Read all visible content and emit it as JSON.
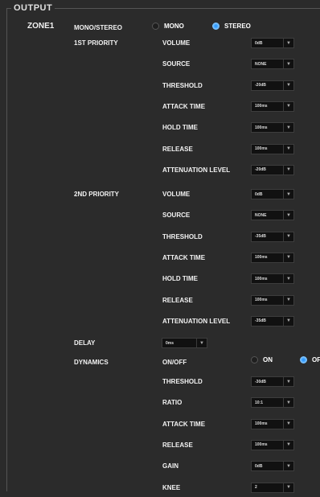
{
  "section_title": "OUTPUT",
  "zone_label": "ZONE1",
  "mono_stereo": {
    "label": "MONO/STEREO",
    "options": [
      "MONO",
      "STEREO"
    ],
    "selected": "STEREO"
  },
  "priority1": {
    "label": "1ST PRIORITY",
    "rows": [
      {
        "label": "VOLUME",
        "value": "0dB"
      },
      {
        "label": "SOURCE",
        "value": "NONE"
      },
      {
        "label": "THRESHOLD",
        "value": "-20dB"
      },
      {
        "label": "ATTACK TIME",
        "value": "100ms"
      },
      {
        "label": "HOLD TIME",
        "value": "100ms"
      },
      {
        "label": "RELEASE",
        "value": "100ms"
      },
      {
        "label": "ATTENUATION LEVEL",
        "value": "-20dB"
      }
    ]
  },
  "priority2": {
    "label": "2ND PRIORITY",
    "rows": [
      {
        "label": "VOLUME",
        "value": "0dB"
      },
      {
        "label": "SOURCE",
        "value": "NONE"
      },
      {
        "label": "THRESHOLD",
        "value": "-35dB"
      },
      {
        "label": "ATTACK TIME",
        "value": "100ms"
      },
      {
        "label": "HOLD TIME",
        "value": "100ms"
      },
      {
        "label": "RELEASE",
        "value": "100ms"
      },
      {
        "label": "ATTENUATION LEVEL",
        "value": "-35dB"
      }
    ]
  },
  "delay": {
    "label": "DELAY",
    "value": "0ms"
  },
  "dynamics": {
    "label": "DYNAMICS",
    "onoff": {
      "label": "ON/OFF",
      "options": [
        "ON",
        "OFF"
      ],
      "selected": "OFF"
    },
    "rows": [
      {
        "label": "THRESHOLD",
        "value": "-30dB"
      },
      {
        "label": "RATIO",
        "value": "10:1"
      },
      {
        "label": "ATTACK TIME",
        "value": "100ms"
      },
      {
        "label": "RELEASE",
        "value": "100ms"
      },
      {
        "label": "GAIN",
        "value": "0dB"
      },
      {
        "label": "KNEE",
        "value": "2"
      }
    ]
  },
  "icons": {
    "dropdown": "chevron-down-icon"
  },
  "colors": {
    "background": "#2b2b2b",
    "radio_selected": "#2f9bff",
    "select_bg": "#111111"
  }
}
